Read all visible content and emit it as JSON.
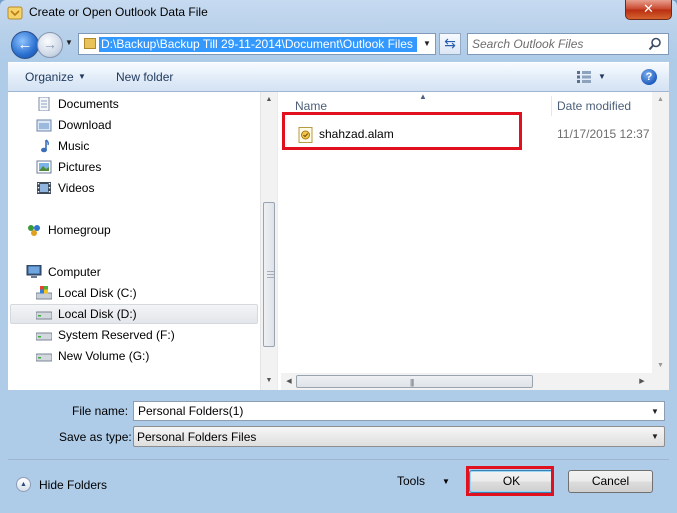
{
  "window": {
    "title": "Create or Open Outlook Data File",
    "close_label": "✕"
  },
  "nav": {
    "address_path": "D:\\Backup\\Backup Till 29-11-2014\\Document\\Outlook Files",
    "search_placeholder": "Search Outlook Files"
  },
  "toolbar": {
    "organize_label": "Organize",
    "new_folder_label": "New folder",
    "help_label": "?"
  },
  "sidebar": {
    "items": [
      {
        "label": "Documents",
        "icon": "documents-icon"
      },
      {
        "label": "Download",
        "icon": "download-folder-icon"
      },
      {
        "label": "Music",
        "icon": "music-icon"
      },
      {
        "label": "Pictures",
        "icon": "pictures-icon"
      },
      {
        "label": "Videos",
        "icon": "videos-icon"
      },
      {
        "label": "Homegroup",
        "icon": "homegroup-icon"
      },
      {
        "label": "Computer",
        "icon": "computer-icon"
      },
      {
        "label": "Local Disk (C:)",
        "icon": "system-drive-icon"
      },
      {
        "label": "Local Disk (D:)",
        "icon": "drive-icon"
      },
      {
        "label": "System Reserved (F:)",
        "icon": "drive-icon"
      },
      {
        "label": "New Volume (G:)",
        "icon": "drive-icon"
      }
    ],
    "selected_index": 8
  },
  "files": {
    "columns": {
      "name": "Name",
      "date_modified": "Date modified"
    },
    "rows": [
      {
        "name": "shahzad.alam",
        "date_modified": "11/17/2015 12:37 ..."
      }
    ]
  },
  "form": {
    "file_name_label": "File name:",
    "file_name_value": "Personal Folders(1)",
    "save_as_type_label": "Save as type:",
    "save_as_type_value": "Personal Folders Files"
  },
  "buttons": {
    "hide_folders": "Hide Folders",
    "tools": "Tools",
    "ok": "OK",
    "cancel": "Cancel"
  },
  "colors": {
    "highlight_annotation": "#e0101e",
    "address_selection": "#3399ff",
    "close_button": "#c7442a"
  }
}
